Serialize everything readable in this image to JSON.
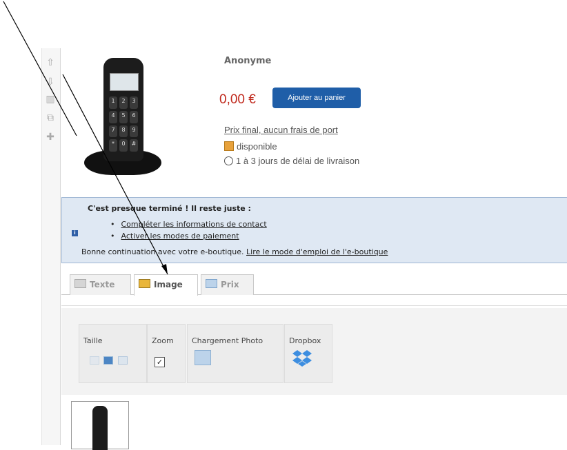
{
  "left_toolbar": {
    "icons": [
      "arrow-up-icon",
      "arrow-down-icon",
      "trash-icon",
      "copy-icon",
      "add-icon"
    ]
  },
  "product": {
    "seller": "Anonyme",
    "price": "0,00 €",
    "cart_button": "Ajouter au panier",
    "final_price_link": "Prix final, aucun frais de port",
    "availability": "disponible",
    "delivery": "1 à 3 jours de délai de livraison",
    "image_keys": [
      "1",
      "2",
      "3",
      "4",
      "5",
      "6",
      "7",
      "8",
      "9",
      "*",
      "0",
      "#"
    ]
  },
  "notice": {
    "title": "C'est presque terminé ! Il reste juste :",
    "items": [
      "Compléter les informations de contact",
      "Activer les modes de paiement"
    ],
    "footer_text": "Bonne continuation avec votre e-boutique.",
    "footer_link": "Lire le mode d'emploi de l'e-boutique"
  },
  "tabs": [
    {
      "label": "Texte",
      "active": false
    },
    {
      "label": "Image",
      "active": true
    },
    {
      "label": "Prix",
      "active": false
    }
  ],
  "image_panel": {
    "size_label": "Taille",
    "zoom_label": "Zoom",
    "zoom_checked": "✓",
    "upload_label": "Chargement Photo",
    "dropbox_label": "Dropbox"
  },
  "colors": {
    "price": "#c0281c",
    "cart_button": "#1f5ea8",
    "notice_bg": "#dfe8f3",
    "notice_border": "#9db5d3"
  }
}
